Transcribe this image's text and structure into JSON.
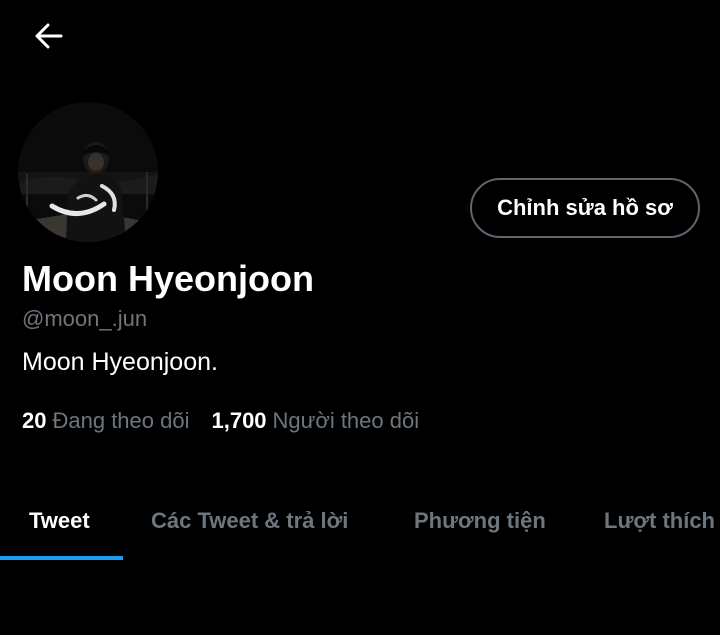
{
  "header": {
    "back_icon": "arrow-left-icon"
  },
  "profile": {
    "avatar": "profile-photo",
    "edit_button_label": "Chỉnh sửa hồ sơ",
    "display_name": "Moon Hyeonjoon",
    "handle": "@moon_.jun",
    "bio": "Moon Hyeonjoon.",
    "following_count": "20",
    "following_label": "Đang theo dõi",
    "followers_count": "1,700",
    "followers_label": "Người theo dõi"
  },
  "tabs": [
    {
      "label": "Tweet",
      "active": true
    },
    {
      "label": "Các Tweet & trả lời",
      "active": false
    },
    {
      "label": "Phương tiện",
      "active": false
    },
    {
      "label": "Lượt thích",
      "active": false
    }
  ],
  "colors": {
    "background": "#000000",
    "text_primary": "#ffffff",
    "text_secondary": "#6e767d",
    "accent": "#1d9bf0",
    "button_border": "#5b6670"
  }
}
